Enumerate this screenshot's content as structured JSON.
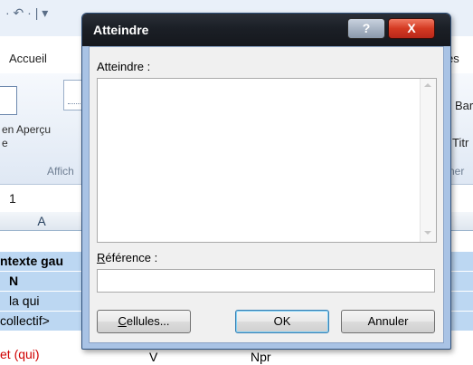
{
  "background": {
    "qat": "· ↶ · | ▾",
    "tab_left": "Accueil",
    "tab_right": "es",
    "ribbon_label_1": "en Aperçu",
    "ribbon_label_1b": "e",
    "ribbon_group_left": "Affich",
    "ribbon_right_1": "Bar",
    "ribbon_right_2": "Titr",
    "ribbon_group_right": "ner",
    "name_box": "1",
    "column_header_a": "A",
    "rows": [
      {
        "text": "ntexte gau",
        "color": "#000000",
        "bold": true
      },
      {
        "text": "N",
        "color": "#000000",
        "bold": true
      },
      {
        "text": "la qui",
        "color": "#000000",
        "bold": false
      },
      {
        "text": "collectif>",
        "color": "#000000",
        "bold": false
      },
      {
        "text": "et (qui)",
        "color": "#d00000",
        "bold": false
      }
    ],
    "bottom_row_b": "V",
    "bottom_row_c": "Npr"
  },
  "dialog": {
    "title": "Atteindre",
    "help_glyph": "?",
    "close_glyph": "X",
    "goto_label": "Atteindre :",
    "goto_items": [],
    "reference_label_first": "R",
    "reference_label_rest": "éférence :",
    "reference_value": "",
    "cells_button_first": "C",
    "cells_button_rest": "ellules...",
    "ok_button": "OK",
    "cancel_button": "Annuler"
  }
}
